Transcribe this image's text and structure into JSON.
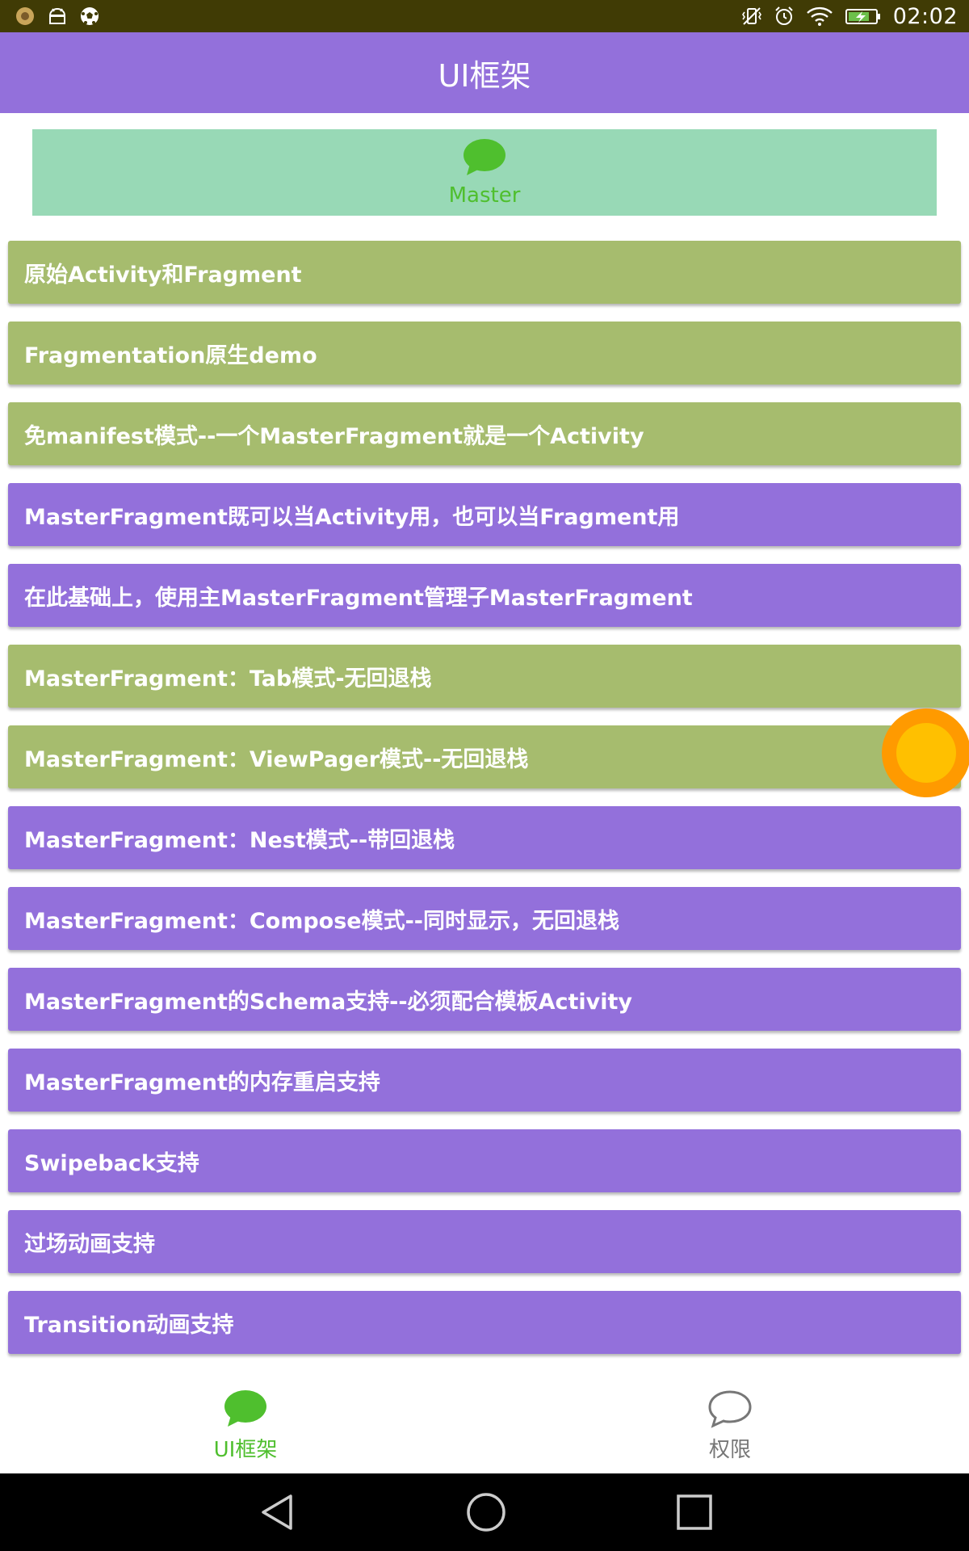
{
  "status_bar": {
    "time": "02:02",
    "left_icons": [
      "app-icon",
      "android-debug-icon",
      "soccer-ball-icon"
    ],
    "right_icons": [
      "vibrate-icon",
      "alarm-icon",
      "wifi-icon",
      "battery-charging-icon"
    ]
  },
  "header": {
    "title": "UI框架"
  },
  "banner": {
    "icon": "chat-bubble-icon",
    "label": "Master",
    "background": "#98D9B6",
    "label_color": "#4FBF2E"
  },
  "menu": {
    "items": [
      {
        "label": "原始Activity和Fragment",
        "color": "green"
      },
      {
        "label": "Fragmentation原生demo",
        "color": "green"
      },
      {
        "label": "免manifest模式--一个MasterFragment就是一个Activity",
        "color": "green"
      },
      {
        "label": "MasterFragment既可以当Activity用，也可以当Fragment用",
        "color": "purple"
      },
      {
        "label": "在此基础上，使用主MasterFragment管理子MasterFragment",
        "color": "purple"
      },
      {
        "label": "MasterFragment：Tab模式-无回退栈",
        "color": "green"
      },
      {
        "label": "MasterFragment：ViewPager模式--无回退栈",
        "color": "green"
      },
      {
        "label": "MasterFragment：Nest模式--带回退栈",
        "color": "purple"
      },
      {
        "label": "MasterFragment：Compose模式--同时显示，无回退栈",
        "color": "purple"
      },
      {
        "label": "MasterFragment的Schema支持--必须配合模板Activity",
        "color": "purple"
      },
      {
        "label": "MasterFragment的内存重启支持",
        "color": "purple"
      },
      {
        "label": "Swipeback支持",
        "color": "purple"
      },
      {
        "label": "过场动画支持",
        "color": "purple"
      },
      {
        "label": "Transition动画支持",
        "color": "purple"
      }
    ]
  },
  "tabs": [
    {
      "label": "UI框架",
      "icon": "chat-bubble-filled-icon",
      "active": true
    },
    {
      "label": "权限",
      "icon": "chat-bubble-outline-icon",
      "active": false
    }
  ],
  "nav": {
    "buttons": [
      "back-icon",
      "home-icon",
      "recents-icon"
    ]
  },
  "colors": {
    "purple": "#9370DB",
    "green": "#A6BC6E",
    "status_bar": "#403B05",
    "accent_green": "#4FBF2E",
    "fab_outer": "#FF9A00",
    "fab_inner": "#FFC000"
  }
}
